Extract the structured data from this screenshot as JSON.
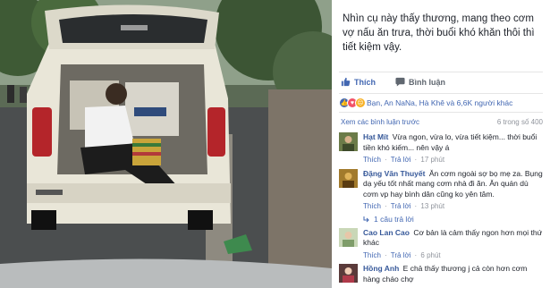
{
  "post": {
    "caption": "Nhìn cụ này thấy thương, mang theo cơm vợ nấu ăn trưa, thời buổi khó khăn thôi thì tiết kiệm vậy."
  },
  "actions": {
    "like_label": "Thích",
    "comment_label": "Bình luận"
  },
  "reactions": {
    "summary": "Bạn, An NaNa, Hà Khê và 6,6K người khác"
  },
  "comments_header": {
    "view_previous": "Xem các bình luận trước",
    "count": "6 trong số 400"
  },
  "comments": [
    {
      "name": "Hạt Mít",
      "text": "Vừa ngon, vừa lo, vừa tiết kiệm... thời buổi tiền khó kiếm... nên vậy á",
      "like": "Thích",
      "reply": "Trả lời",
      "time": "17 phút"
    },
    {
      "name": "Đặng Văn Thuyết",
      "text": "Ăn cơm ngoài sợ bọ mẹ za. Bụng dạ yếu tốt nhất mang cơm nhà đi ăn. Ăn quán dù cơm vp hay bình dân cũng ko yên tâm.",
      "like": "Thích",
      "reply": "Trả lời",
      "time": "13 phút",
      "replies": "1 câu trả lời"
    },
    {
      "name": "Cao Lan Cao",
      "text": "Cơ bản là cảm thấy ngon hơn mọi thứ khác",
      "like": "Thích",
      "reply": "Trả lời",
      "time": "6 phút"
    },
    {
      "name": "Hồng Anh",
      "text": "E chả thấy thương j cả còn hơn cơm hàng cháo chợ"
    }
  ],
  "colors": {
    "brand_blue": "#4267b2",
    "name_blue": "#365899",
    "meta_gray": "#90949c"
  },
  "icons": [
    "thumbs-up-icon",
    "comment-bubble-icon",
    "like-reaction-icon",
    "love-reaction-icon",
    "sad-reaction-icon",
    "reply-arrow-icon"
  ]
}
